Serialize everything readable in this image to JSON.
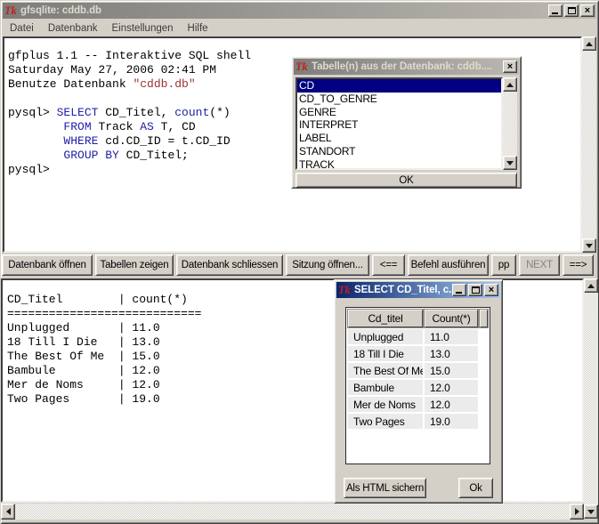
{
  "window": {
    "title": "gfsqlite: cddb.db",
    "app_icon": "tk-feather-logo"
  },
  "menu": {
    "items": [
      "Datei",
      "Datenbank",
      "Einstellungen",
      "Hilfe"
    ]
  },
  "shell": {
    "lines": [
      [
        {
          "t": "gfplus 1.1 -- Interaktive SQL shell",
          "c": "k"
        }
      ],
      [
        {
          "t": "Saturday May 27, 2006 02:41 PM",
          "c": "k"
        }
      ],
      [
        {
          "t": "Benutze Datenbank ",
          "c": "k"
        },
        {
          "t": "\"cddb.db\"",
          "c": "r"
        }
      ],
      [
        {
          "t": " ",
          "c": "k"
        }
      ],
      [
        {
          "t": "pysql> ",
          "c": "k"
        },
        {
          "t": "SELECT",
          "c": "b"
        },
        {
          "t": " CD_Titel, ",
          "c": "k"
        },
        {
          "t": "count",
          "c": "b"
        },
        {
          "t": "(*)",
          "c": "k"
        }
      ],
      [
        {
          "t": "        ",
          "c": "k"
        },
        {
          "t": "FROM",
          "c": "b"
        },
        {
          "t": " Track ",
          "c": "k"
        },
        {
          "t": "AS",
          "c": "b"
        },
        {
          "t": " T, CD",
          "c": "k"
        }
      ],
      [
        {
          "t": "        ",
          "c": "k"
        },
        {
          "t": "WHERE",
          "c": "b"
        },
        {
          "t": " cd.CD_ID = t.CD_ID",
          "c": "k"
        }
      ],
      [
        {
          "t": "        ",
          "c": "k"
        },
        {
          "t": "GROUP BY",
          "c": "b"
        },
        {
          "t": " CD_Titel;",
          "c": "k"
        }
      ],
      [
        {
          "t": "pysql>",
          "c": "k"
        }
      ]
    ]
  },
  "toolbar": {
    "buttons": [
      {
        "label": "Datenbank öffnen",
        "disabled": false
      },
      {
        "label": "Tabellen zeigen",
        "disabled": false
      },
      {
        "label": "Datenbank schliessen",
        "disabled": false
      },
      {
        "label": "Sitzung öffnen...",
        "disabled": false
      },
      {
        "label": "<==",
        "disabled": false
      },
      {
        "label": "Befehl ausführen",
        "disabled": false
      },
      {
        "label": "pp",
        "disabled": false
      },
      {
        "label": "NEXT",
        "disabled": true
      },
      {
        "label": "==>",
        "disabled": false
      }
    ]
  },
  "results": {
    "lines": [
      "CD_Titel        | count(*)",
      "============================",
      "Unplugged       | 11.0",
      "18 Till I Die   | 13.0",
      "The Best Of Me  | 15.0",
      "Bambule         | 12.0",
      "Mer de Noms     | 12.0",
      "Two Pages       | 19.0"
    ]
  },
  "tables_dialog": {
    "title": "Tabelle(n) aus der Datenbank: cddb....",
    "items": [
      "CD",
      "CD_TO_GENRE",
      "GENRE",
      "INTERPRET",
      "LABEL",
      "STANDORT",
      "TRACK"
    ],
    "selected_index": 0,
    "ok_label": "OK"
  },
  "result_dialog": {
    "title": "SELECT CD_Titel, c...",
    "columns": [
      "Cd_titel",
      "Count(*)"
    ],
    "rows": [
      [
        "Unplugged",
        "11.0"
      ],
      [
        "18 Till I Die",
        "13.0"
      ],
      [
        "The Best Of Me",
        "15.0"
      ],
      [
        "Bambule",
        "12.0"
      ],
      [
        "Mer de Noms",
        "12.0"
      ],
      [
        "Two Pages",
        "19.0"
      ]
    ],
    "save_html_label": "Als HTML sichern",
    "ok_label": "Ok"
  },
  "colors": {
    "window_face": "#d4d0c8",
    "active_title_start": "#0a246a",
    "active_title_end": "#a6caf0",
    "inactive_title_start": "#7d7d7a",
    "inactive_title_end": "#bcb9b1",
    "list_selection": "#000080",
    "sql_keyword": "#2121a8",
    "sql_string": "#9b3333"
  }
}
